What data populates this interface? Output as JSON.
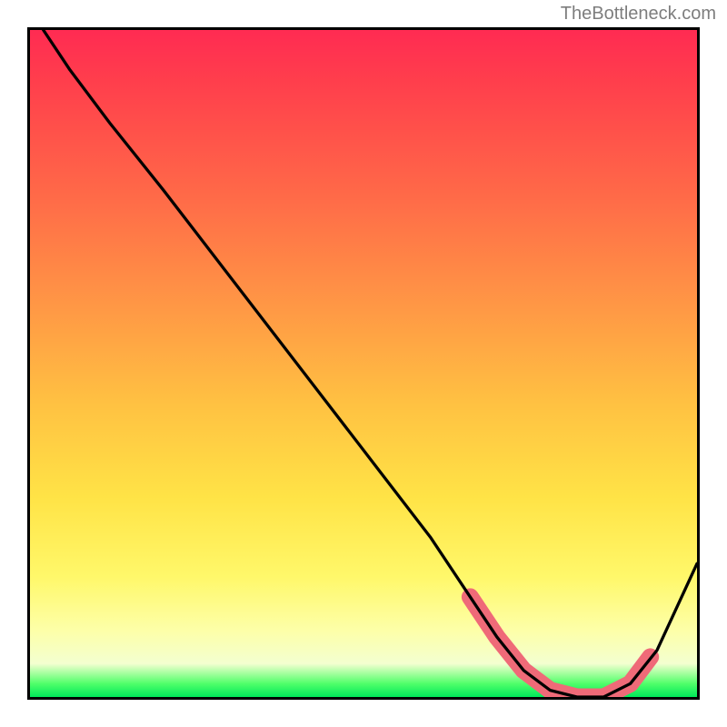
{
  "watermark": {
    "text": "TheBottleneck.com"
  },
  "chart_data": {
    "type": "line",
    "title": "",
    "xlabel": "",
    "ylabel": "",
    "xlim": [
      0,
      100
    ],
    "ylim": [
      0,
      100
    ],
    "grid": false,
    "series": [
      {
        "name": "curve",
        "color": "#000000",
        "x": [
          2,
          6,
          12,
          20,
          30,
          40,
          50,
          60,
          66,
          70,
          74,
          78,
          82,
          86,
          90,
          94,
          100
        ],
        "y": [
          100,
          94,
          86,
          76,
          63,
          50,
          37,
          24,
          15,
          9,
          4,
          1,
          0,
          0,
          2,
          7,
          20
        ]
      },
      {
        "name": "highlight-band",
        "color": "#ef6a78",
        "style": "thick",
        "x": [
          66,
          70,
          74,
          78,
          82,
          86,
          90,
          93
        ],
        "y": [
          15,
          9,
          4,
          1,
          0,
          0,
          2,
          6
        ]
      }
    ],
    "background": {
      "type": "vertical-gradient",
      "stops": [
        {
          "pos": 0,
          "color": "#ff2b52"
        },
        {
          "pos": 25,
          "color": "#ff6a48"
        },
        {
          "pos": 56,
          "color": "#ffc142"
        },
        {
          "pos": 82,
          "color": "#fff86a"
        },
        {
          "pos": 95,
          "color": "#f3ffd0"
        },
        {
          "pos": 100,
          "color": "#00e85a"
        }
      ]
    }
  }
}
